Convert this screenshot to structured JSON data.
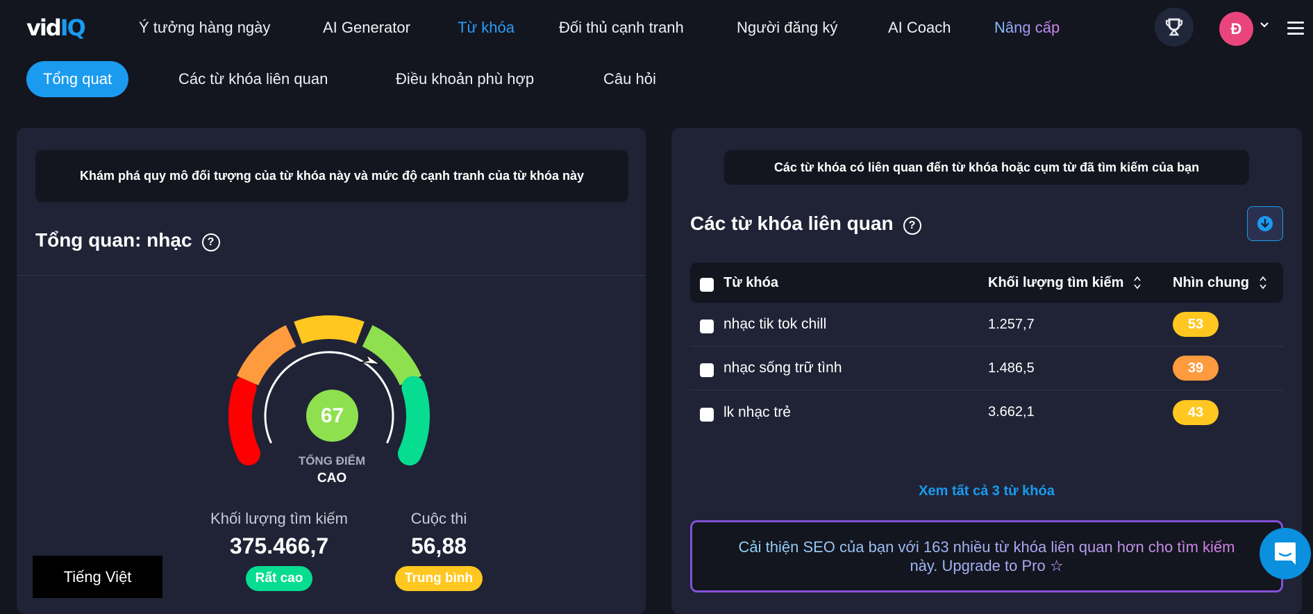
{
  "nav": {
    "logo": {
      "part1": "vid",
      "part2": "IQ"
    },
    "items": [
      {
        "label": "Ý tưởng hàng ngày",
        "active": false
      },
      {
        "label": "AI Generator",
        "active": false
      },
      {
        "label": "Từ khóa",
        "active": true
      },
      {
        "label": "Đối thủ cạnh tranh",
        "active": false
      },
      {
        "label": "Người đăng ký",
        "active": false
      },
      {
        "label": "AI Coach",
        "active": false
      }
    ],
    "upgrade_label": "Nâng cấp",
    "trophy_icon": "trophy-icon",
    "avatar_initial": "Đ",
    "avatar_color": "#e9457c",
    "menu_icon": "hamburger-icon"
  },
  "subtabs": [
    {
      "label": "Tổng quat",
      "active": true
    },
    {
      "label": "Các từ khóa liên quan",
      "active": false
    },
    {
      "label": "Điều khoản phù hợp",
      "active": false
    },
    {
      "label": "Câu hỏi",
      "active": false
    }
  ],
  "overview": {
    "info": "Khám phá quy mô đối tượng của từ khóa này và mức độ cạnh tranh của từ khóa này",
    "title": "Tổng quan: nhạc",
    "help_icon": "?",
    "gauge": {
      "score": "67",
      "score_fraction": 0.67,
      "label": "TỔNG ĐIỂM",
      "level": "CAO",
      "segments": [
        {
          "color": "#ff0000"
        },
        {
          "color": "#fd9b3e"
        },
        {
          "color": "#ffc720"
        },
        {
          "color": "#8ee04f"
        },
        {
          "color": "#07dd91"
        }
      ],
      "score_color": "#8ee04f"
    },
    "metrics": {
      "volume": {
        "label": "Khối lượng tìm kiếm",
        "value": "375.466,7",
        "badge": "Rất cao",
        "badge_color": "#07dd91"
      },
      "competition": {
        "label": "Cuộc thi",
        "value": "56,88",
        "badge": "Trung bình",
        "badge_color": "#ffc720"
      }
    }
  },
  "language": "Tiếng Việt",
  "related": {
    "info": "Các từ khóa có liên quan đến từ khóa hoặc cụm từ đã tìm kiếm của bạn",
    "title": "Các từ khóa liên quan",
    "help_icon": "?",
    "download_icon": "download-icon",
    "columns": {
      "keyword": "Từ khóa",
      "volume": "Khối lượng tìm kiếm",
      "overall": "Nhìn chung"
    },
    "rows": [
      {
        "keyword": "nhạc tik tok chill",
        "volume": "1.257,7",
        "overall": "53",
        "color": "#ffc720"
      },
      {
        "keyword": "nhạc sống trữ tình",
        "volume": "1.486,5",
        "overall": "39",
        "color": "#fd9b3e"
      },
      {
        "keyword": "lk nhạc trẻ",
        "volume": "3.662,1",
        "overall": "43",
        "color": "#ffc720"
      }
    ],
    "see_all": "Xem tất cả 3 từ khóa",
    "upgrade": "Cải thiện SEO của bạn với 163 nhiều từ khóa liên quan hơn cho tìm kiếm này. Upgrade to Pro",
    "upgrade_icon": "☆"
  },
  "chat_icon": "chat-icon"
}
